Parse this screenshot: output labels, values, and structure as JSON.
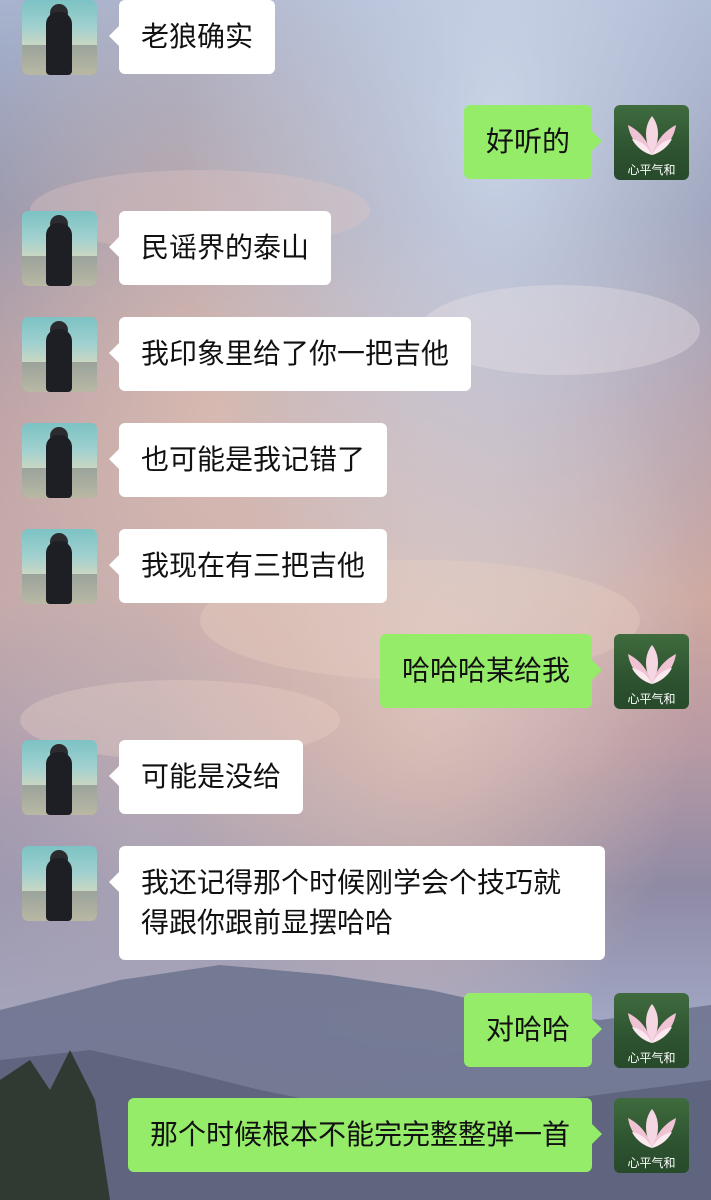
{
  "chat": {
    "friend_avatar_icon": "person-photo-icon",
    "self_avatar_icon": "lotus-icon",
    "self_avatar_caption": "心平气和",
    "bubble_colors": {
      "incoming": "#ffffff",
      "outgoing": "#95ec69"
    },
    "messages": [
      {
        "side": "left",
        "text": "老狼确实"
      },
      {
        "side": "right",
        "text": "好听的"
      },
      {
        "side": "left",
        "text": "民谣界的泰山"
      },
      {
        "side": "left",
        "text": "我印象里给了你一把吉他"
      },
      {
        "side": "left",
        "text": "也可能是我记错了"
      },
      {
        "side": "left",
        "text": "我现在有三把吉他"
      },
      {
        "side": "right",
        "text": "哈哈哈某给我"
      },
      {
        "side": "left",
        "text": "可能是没给"
      },
      {
        "side": "left",
        "text": "我还记得那个时候刚学会个技巧就得跟你跟前显摆哈哈"
      },
      {
        "side": "right",
        "text": "对哈哈"
      },
      {
        "side": "right",
        "text": "那个时候根本不能完完整整弹一首"
      }
    ]
  }
}
